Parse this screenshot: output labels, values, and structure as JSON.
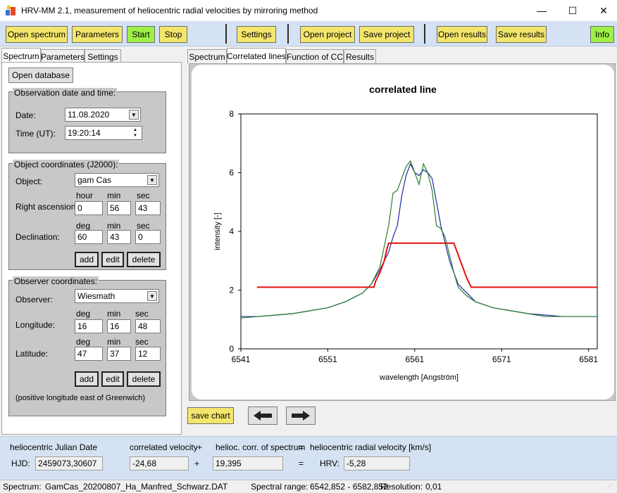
{
  "window": {
    "title": "HRV-MM 2.1,   measurement of heliocentric radial velocities by mirroring method"
  },
  "toolbar": {
    "open_spectrum": "Open spectrum",
    "parameters": "Parameters",
    "start": "Start",
    "stop": "Stop",
    "settings": "Settings",
    "open_project": "Open project",
    "save_project": "Save project",
    "open_results": "Open results",
    "save_results": "Save results",
    "info": "Info"
  },
  "left_tabs": [
    "Spectrum",
    "Parameters",
    "Settings"
  ],
  "open_database": "Open database",
  "observation": {
    "group_title": "Observation date and time:",
    "date_label": "Date:",
    "date_value": "11.08.2020",
    "time_label": "Time (UT):",
    "time_value": "19:20:14"
  },
  "object": {
    "group_title": "Object coordinates (J2000):",
    "object_label": "Object:",
    "object_value": "gam Cas",
    "ra_label": "Right ascension:",
    "ra_headers": [
      "hour",
      "min",
      "sec"
    ],
    "ra_values": [
      "0",
      "56",
      "43"
    ],
    "dec_label": "Declination:",
    "dec_headers": [
      "deg",
      "min",
      "sec"
    ],
    "dec_values": [
      "60",
      "43",
      "0"
    ],
    "add": "add",
    "edit": "edit",
    "delete": "delete"
  },
  "observer": {
    "group_title": "Observer coordinates:",
    "observer_label": "Observer:",
    "observer_value": "Wiesmath",
    "lon_label": "Longitude:",
    "lon_headers": [
      "deg",
      "min",
      "sec"
    ],
    "lon_values": [
      "16",
      "16",
      "48"
    ],
    "lat_label": "Latitude:",
    "lat_headers": [
      "deg",
      "min",
      "sec"
    ],
    "lat_values": [
      "47",
      "37",
      "12"
    ],
    "add": "add",
    "edit": "edit",
    "delete": "delete",
    "note": "(positive longitude east of Greenwich)"
  },
  "right_tabs": [
    "Spectrum",
    "Correlated lines",
    "Function of CC",
    "Results"
  ],
  "chart_data": {
    "type": "line",
    "title": "correlated line",
    "xlabel": "wavelength [Angström]",
    "ylabel": "intensity [-]",
    "xlim": [
      6541,
      6582
    ],
    "ylim": [
      0,
      8
    ],
    "xticks": [
      6541,
      6551,
      6561,
      6571,
      6581
    ],
    "yticks": [
      0,
      2,
      4,
      6,
      8
    ],
    "grid": false,
    "series": [
      {
        "color": "#1a2aa8",
        "x": [
          6541,
          6543,
          6545,
          6547,
          6549,
          6551,
          6553,
          6555,
          6556,
          6557,
          6557.5,
          6558,
          6558.5,
          6559,
          6559.5,
          6560,
          6560.5,
          6561,
          6561.5,
          6562,
          6562.5,
          6563,
          6563.5,
          6564,
          6564.5,
          6565,
          6565.5,
          6566,
          6567,
          6568,
          6570,
          6572,
          6574,
          6576,
          6578,
          6580,
          6582
        ],
        "y": [
          1.1,
          1.1,
          1.15,
          1.2,
          1.3,
          1.4,
          1.6,
          1.9,
          2.2,
          2.7,
          3.0,
          3.3,
          3.8,
          4.2,
          5.2,
          5.9,
          6.3,
          6.0,
          5.9,
          6.1,
          6.0,
          5.8,
          5.0,
          4.2,
          3.6,
          3.0,
          2.6,
          2.2,
          1.9,
          1.6,
          1.4,
          1.3,
          1.2,
          1.15,
          1.1,
          1.1,
          1.1
        ]
      },
      {
        "color": "#2e7d2e",
        "x": [
          6541,
          6543,
          6545,
          6547,
          6549,
          6551,
          6553,
          6555,
          6556,
          6557,
          6557.5,
          6558,
          6558.5,
          6559,
          6559.5,
          6560,
          6560.5,
          6561,
          6561.5,
          6562,
          6562.5,
          6563,
          6563.5,
          6564,
          6564.5,
          6565,
          6565.5,
          6566,
          6567,
          6568,
          6570,
          6572,
          6574,
          6576,
          6578,
          6580,
          6582
        ],
        "y": [
          1.05,
          1.1,
          1.15,
          1.2,
          1.3,
          1.4,
          1.6,
          1.9,
          2.2,
          2.8,
          3.5,
          4.2,
          5.3,
          5.4,
          5.8,
          6.2,
          6.4,
          6.0,
          5.6,
          6.3,
          6.0,
          5.4,
          4.2,
          4.1,
          3.8,
          3.2,
          2.6,
          2.1,
          1.8,
          1.6,
          1.4,
          1.3,
          1.2,
          1.1,
          1.1,
          1.1,
          1.1
        ]
      },
      {
        "color": "#e01010",
        "x": [
          6542.852,
          6556.3,
          6556.5,
          6557,
          6557.5,
          6557.8,
          6558,
          6565.5,
          6566,
          6566.5,
          6567,
          6567.5,
          6582.852
        ],
        "y": [
          2.1,
          2.1,
          2.3,
          2.6,
          3.0,
          3.4,
          3.6,
          3.6,
          3.2,
          2.8,
          2.4,
          2.1,
          2.1
        ]
      }
    ]
  },
  "save_chart": "save chart",
  "bottom": {
    "hjd_header": "heliocentric Julian Date",
    "cv_header": "correlated velocity",
    "plus1": "+",
    "corr_header": "helioc. corr. of spectrum",
    "eq1": "=",
    "hrv_header": "heliocentric radial velocity [km/s]",
    "hjd_label": "HJD:",
    "hjd_value": "2459073,30607",
    "cv_value": "-24,68",
    "plus2": "+",
    "corr_value": "19,395",
    "eq2": "=",
    "hrv_label": "HRV:",
    "hrv_value": "-5,28"
  },
  "status": {
    "spectrum_label": "Spectrum:",
    "spectrum_value": "GamCas_20200807_Ha_Manfred_Schwarz.DAT",
    "range_label": "Spectral range:",
    "range_value": "6542,852 - 6582,852",
    "res_label": "Resolution:",
    "res_value": "0,01"
  }
}
